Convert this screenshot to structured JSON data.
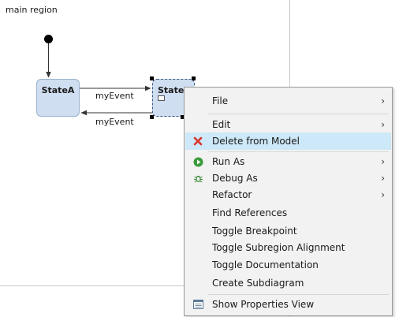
{
  "diagram": {
    "region_label": "main region",
    "states": [
      {
        "name": "StateA"
      },
      {
        "name": "StateB"
      }
    ],
    "transitions": [
      {
        "label": "myEvent"
      },
      {
        "label": "myEvent"
      }
    ]
  },
  "context_menu": {
    "items": [
      {
        "label": "File",
        "submenu": true
      },
      {
        "label": "Edit",
        "submenu": true
      },
      {
        "label": "Delete from Model",
        "icon": "delete-icon",
        "icon_color": "#d9342b",
        "selected": true
      },
      {
        "label": "Run As",
        "icon": "run-icon",
        "icon_color": "#3a9b3a",
        "submenu": true
      },
      {
        "label": "Debug As",
        "icon": "debug-icon",
        "icon_color": "#3a8a3a",
        "submenu": true
      },
      {
        "label": "Refactor",
        "submenu": true
      },
      {
        "label": "Find References"
      },
      {
        "label": "Toggle Breakpoint"
      },
      {
        "label": "Toggle Subregion Alignment"
      },
      {
        "label": "Toggle Documentation"
      },
      {
        "label": "Create Subdiagram"
      },
      {
        "label": "Show Properties View",
        "icon": "properties-view-icon"
      }
    ],
    "selection_color": "#cde8f8",
    "submenu_glyph": "›"
  }
}
